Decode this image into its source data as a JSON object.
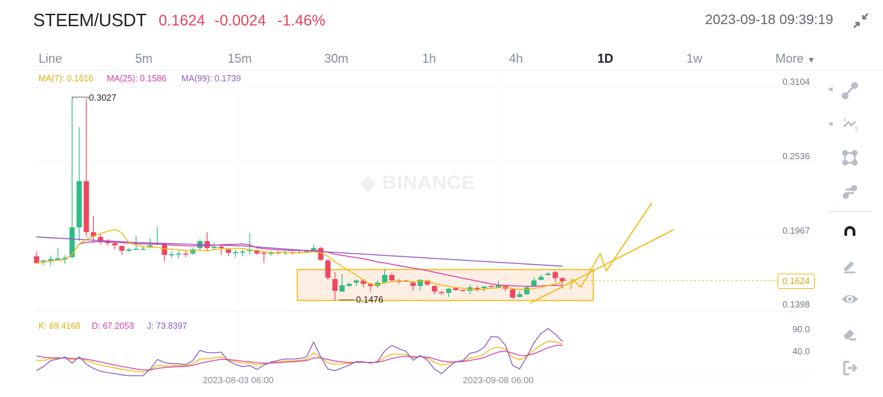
{
  "header": {
    "pair": "STEEM/USDT",
    "last_price": "0.1624",
    "change": "-0.0024",
    "change_pct": "-1.46%",
    "timestamp": "2023-09-18 09:39:19",
    "collapse_icon": "collapse-arrows-icon"
  },
  "tabs": [
    {
      "label": "Line"
    },
    {
      "label": "5m"
    },
    {
      "label": "15m"
    },
    {
      "label": "30m"
    },
    {
      "label": "1h"
    },
    {
      "label": "4h"
    },
    {
      "label": "1D",
      "active": true
    },
    {
      "label": "1w"
    },
    {
      "label": "More"
    }
  ],
  "watermark": "BINANCE",
  "toolbar": [
    "trend-line-icon",
    "fibonacci-icon",
    "rectangle-icon",
    "parallel-channel-icon",
    "magnet-icon",
    "brush-icon",
    "eye-icon",
    "eraser-icon",
    "exit-icon"
  ],
  "colors": {
    "up": "#2ebd85",
    "down": "#f0465f",
    "ma7": "#f0b90b",
    "ma25": "#d63fa6",
    "ma99": "#8a5cc0",
    "k": "#f0b90b",
    "d": "#d63fa6",
    "j": "#8a5cc0"
  },
  "chart_data": [
    {
      "type": "candlestick",
      "interval": "1D",
      "ohlc_order": [
        "open",
        "high",
        "low",
        "close"
      ],
      "candles": [
        [
          0.1815,
          0.1851,
          0.1762,
          0.1762
        ],
        [
          0.1773,
          0.1788,
          0.1746,
          0.1783
        ],
        [
          0.1783,
          0.182,
          0.1746,
          0.1794
        ],
        [
          0.1788,
          0.1878,
          0.1783,
          0.1799
        ],
        [
          0.1794,
          0.1825,
          0.1757,
          0.1804
        ],
        [
          0.1809,
          0.3027,
          0.1799,
          0.2036
        ],
        [
          0.2036,
          0.28,
          0.1931,
          0.2389
        ],
        [
          0.2389,
          0.302,
          0.1967,
          0.1999
        ],
        [
          0.1999,
          0.2125,
          0.1915,
          0.1967
        ],
        [
          0.1962,
          0.1983,
          0.1904,
          0.1931
        ],
        [
          0.1925,
          0.1946,
          0.1899,
          0.1915
        ],
        [
          0.1915,
          0.1931,
          0.1867,
          0.1899
        ],
        [
          0.1894,
          0.1899,
          0.1825,
          0.1857
        ],
        [
          0.1857,
          0.1878,
          0.1846,
          0.1867
        ],
        [
          0.1867,
          0.1973,
          0.1862,
          0.1872
        ],
        [
          0.1867,
          0.1888,
          0.1862,
          0.1872
        ],
        [
          0.1888,
          0.1952,
          0.1883,
          0.1899
        ],
        [
          0.1904,
          0.2041,
          0.1899,
          0.1915
        ],
        [
          0.1915,
          0.192,
          0.1773,
          0.1825
        ],
        [
          0.1825,
          0.1851,
          0.1804,
          0.183
        ],
        [
          0.183,
          0.1857,
          0.1799,
          0.1836
        ],
        [
          0.1836,
          0.1857,
          0.1809,
          0.183
        ],
        [
          0.1836,
          0.1878,
          0.1825,
          0.1867
        ],
        [
          0.1878,
          0.1946,
          0.1867,
          0.1931
        ],
        [
          0.1931,
          0.1999,
          0.1851,
          0.1878
        ],
        [
          0.1878,
          0.192,
          0.1867,
          0.1888
        ],
        [
          0.1888,
          0.1899,
          0.1825,
          0.1878
        ],
        [
          0.1867,
          0.1878,
          0.1815,
          0.1841
        ],
        [
          0.1841,
          0.1867,
          0.1809,
          0.1846
        ],
        [
          0.1846,
          0.1867,
          0.1815,
          0.1851
        ],
        [
          0.1857,
          0.1994,
          0.1825,
          0.1862
        ],
        [
          0.1862,
          0.1867,
          0.1825,
          0.1836
        ],
        [
          0.1841,
          0.1851,
          0.1762,
          0.1836
        ],
        [
          0.1836,
          0.1857,
          0.182,
          0.1841
        ],
        [
          0.1846,
          0.1857,
          0.183,
          0.1841
        ],
        [
          0.1841,
          0.1857,
          0.1825,
          0.1846
        ],
        [
          0.1846,
          0.1851,
          0.183,
          0.1841
        ],
        [
          0.1841,
          0.1857,
          0.1836,
          0.1846
        ],
        [
          0.1851,
          0.1867,
          0.1841,
          0.1857
        ],
        [
          0.1862,
          0.1904,
          0.1857,
          0.1878
        ],
        [
          0.1878,
          0.1888,
          0.1778,
          0.1788
        ],
        [
          0.1783,
          0.1794,
          0.1635,
          0.1651
        ],
        [
          0.1641,
          0.1694,
          0.1476,
          0.1551
        ],
        [
          0.1546,
          0.1683,
          0.1541,
          0.1593
        ],
        [
          0.1588,
          0.1614,
          0.1583,
          0.1604
        ],
        [
          0.1614,
          0.1641,
          0.1588,
          0.163
        ],
        [
          0.163,
          0.1641,
          0.1578,
          0.1604
        ],
        [
          0.1604,
          0.1614,
          0.1546,
          0.1588
        ],
        [
          0.1588,
          0.163,
          0.1572,
          0.1614
        ],
        [
          0.1614,
          0.172,
          0.1604,
          0.1672
        ],
        [
          0.1672,
          0.1688,
          0.1625,
          0.163
        ],
        [
          0.163,
          0.1641,
          0.1604,
          0.1625
        ],
        [
          0.163,
          0.1635,
          0.162,
          0.1625
        ],
        [
          0.1614,
          0.162,
          0.1551,
          0.1588
        ],
        [
          0.1588,
          0.1641,
          0.1551,
          0.1635
        ],
        [
          0.163,
          0.1635,
          0.1593,
          0.1599
        ],
        [
          0.1588,
          0.1593,
          0.1525,
          0.1546
        ],
        [
          0.1541,
          0.1551,
          0.152,
          0.154
        ],
        [
          0.1535,
          0.1572,
          0.1504,
          0.1567
        ],
        [
          0.1572,
          0.1583,
          0.1551,
          0.1557
        ],
        [
          0.1557,
          0.1562,
          0.1546,
          0.1551
        ],
        [
          0.1551,
          0.1599,
          0.1525,
          0.1578
        ],
        [
          0.1572,
          0.1588,
          0.1546,
          0.157
        ],
        [
          0.1572,
          0.1588,
          0.1546,
          0.1583
        ],
        [
          0.1588,
          0.1593,
          0.1583,
          0.1586
        ],
        [
          0.1578,
          0.163,
          0.1572,
          0.1593
        ],
        [
          0.1588,
          0.1593,
          0.1546,
          0.1567
        ],
        [
          0.1562,
          0.1567,
          0.1493,
          0.1499
        ],
        [
          0.1504,
          0.1546,
          0.1499,
          0.1525
        ],
        [
          0.1525,
          0.1588,
          0.152,
          0.1578
        ],
        [
          0.1588,
          0.1657,
          0.1583,
          0.163
        ],
        [
          0.1635,
          0.1672,
          0.163,
          0.1657
        ],
        [
          0.1672,
          0.1694,
          0.1667,
          0.1683
        ],
        [
          0.1694,
          0.1704,
          0.162,
          0.1648
        ],
        [
          0.1648,
          0.1657,
          0.1567,
          0.1624
        ]
      ],
      "ma99_points": [
        {
          "candle": 0,
          "value": 0.1962
        },
        {
          "candle": 14,
          "value": 0.192
        },
        {
          "candle": 29,
          "value": 0.1894
        },
        {
          "candle": 40,
          "value": 0.1851
        },
        {
          "candle": 74,
          "value": 0.1739
        }
      ],
      "legend": {
        "ma7": "MA(7): 0.1616",
        "ma25": "MA(25): 0.1586",
        "ma99": "MA(99): 0.1739"
      },
      "y_ticks": [
        "0.3104",
        "0.2536",
        "0.1967",
        "0.1398"
      ],
      "y_range": [
        0.1398,
        0.3104
      ],
      "high_label": "0.3027",
      "low_label": "0.1476",
      "current_price_label": "0.1624",
      "x_labels": [
        "2023-08-03 06:00",
        "2023-09-08 06:00"
      ],
      "annotations": [
        "rectangle",
        "zigzag-path",
        "trend-line"
      ]
    },
    {
      "type": "line",
      "indicator": "KDJ",
      "legend": {
        "k": "K: 69.4168",
        "d": "D: 67.2053",
        "j": "J: 73.8397"
      },
      "y_ticks": [
        "90.0",
        "40.0"
      ]
    }
  ]
}
